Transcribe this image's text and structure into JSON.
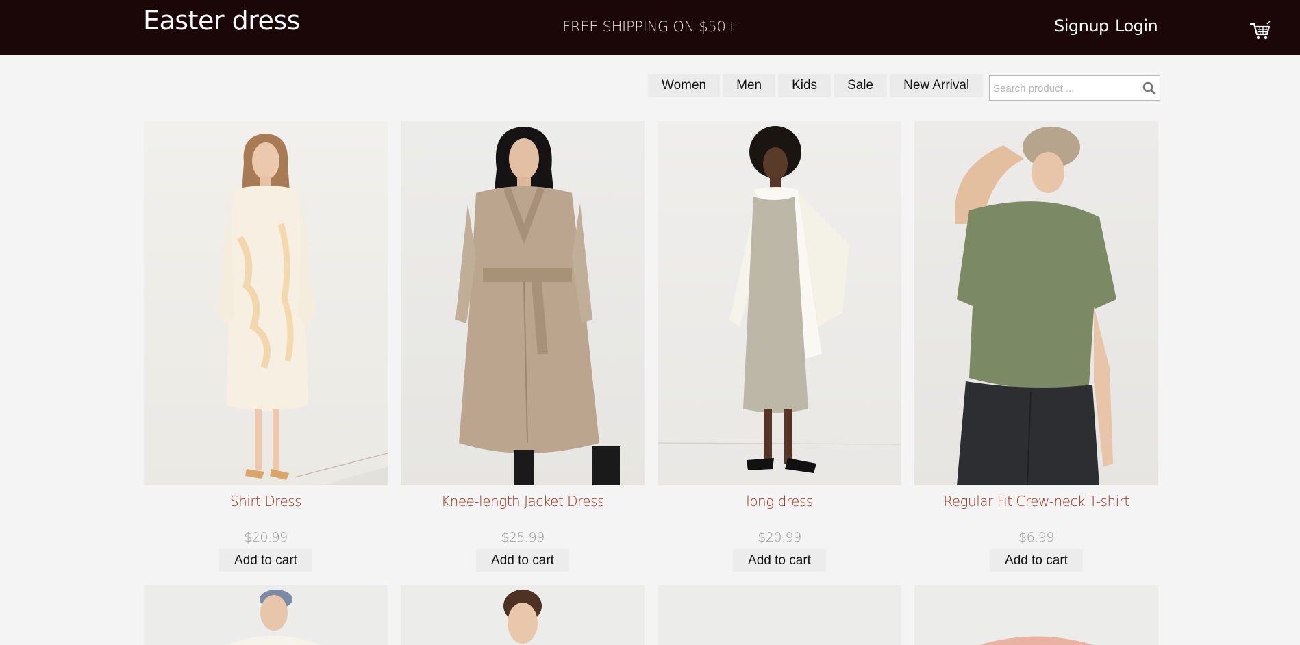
{
  "header": {
    "brand": "Easter dress",
    "promo": "FREE SHIPPING ON $50+",
    "signup": "Signup",
    "login": "Login",
    "cart_icon": "shopping-cart-icon"
  },
  "nav": {
    "items": [
      "Women",
      "Men",
      "Kids",
      "Sale",
      "New Arrival"
    ]
  },
  "search": {
    "placeholder": "Search product ...",
    "value": "",
    "icon": "search-icon"
  },
  "products": [
    {
      "name": "Shirt Dress",
      "price": "$20.99",
      "button": "Add to cart"
    },
    {
      "name": "Knee-length Jacket Dress",
      "price": "$25.99",
      "button": "Add to cart"
    },
    {
      "name": "long dress",
      "price": "$20.99",
      "button": "Add to cart"
    },
    {
      "name": "Regular Fit Crew-neck T-shirt",
      "price": "$6.99",
      "button": "Add to cart"
    }
  ],
  "colors": {
    "header_bg": "#1b0707",
    "product_name": "#a0301e",
    "page_bg": "#f4f4f4"
  }
}
